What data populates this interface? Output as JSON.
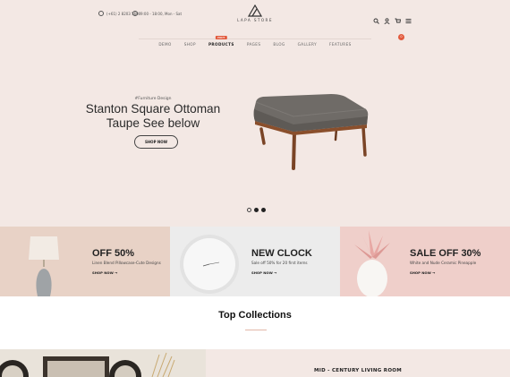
{
  "header": {
    "phone": "(+61) 2 8203 5600",
    "hours": "9:00 - 18:00, Mon - Sat",
    "logo_text": "LAPA STORE",
    "cart_count": "0"
  },
  "nav": {
    "items": [
      {
        "label": "DEMO"
      },
      {
        "label": "SHOP"
      },
      {
        "label": "PRODUCTS",
        "badge": "HOT"
      },
      {
        "label": "PAGES"
      },
      {
        "label": "BLOG"
      },
      {
        "label": "GALLERY"
      },
      {
        "label": "FEATURES"
      }
    ]
  },
  "hero": {
    "tagline": "#Furniture Design",
    "title_line1": "Stanton Square Ottoman",
    "title_line2": "Taupe See below",
    "button": "SHOP NOW",
    "slides_total": 3,
    "active_slide": 2
  },
  "banners": [
    {
      "title": "OFF 50%",
      "subtitle": "Linen Blend Pillowcase-Cute Designs",
      "link": "SHOP NOW"
    },
    {
      "title": "NEW CLOCK",
      "subtitle": "Sale off 50% for 20 first items",
      "link": "SHOP NOW"
    },
    {
      "title": "SALE OFF 30%",
      "subtitle": "White and Nude Ceramic Pineapple",
      "link": "SHOP NOW"
    }
  ],
  "collections": {
    "heading": "Top Collections",
    "first_title": "MID - CENTURY LIVING ROOM"
  },
  "colors": {
    "accent": "#e25a3d",
    "hero_bg": "#f3e8e4"
  }
}
